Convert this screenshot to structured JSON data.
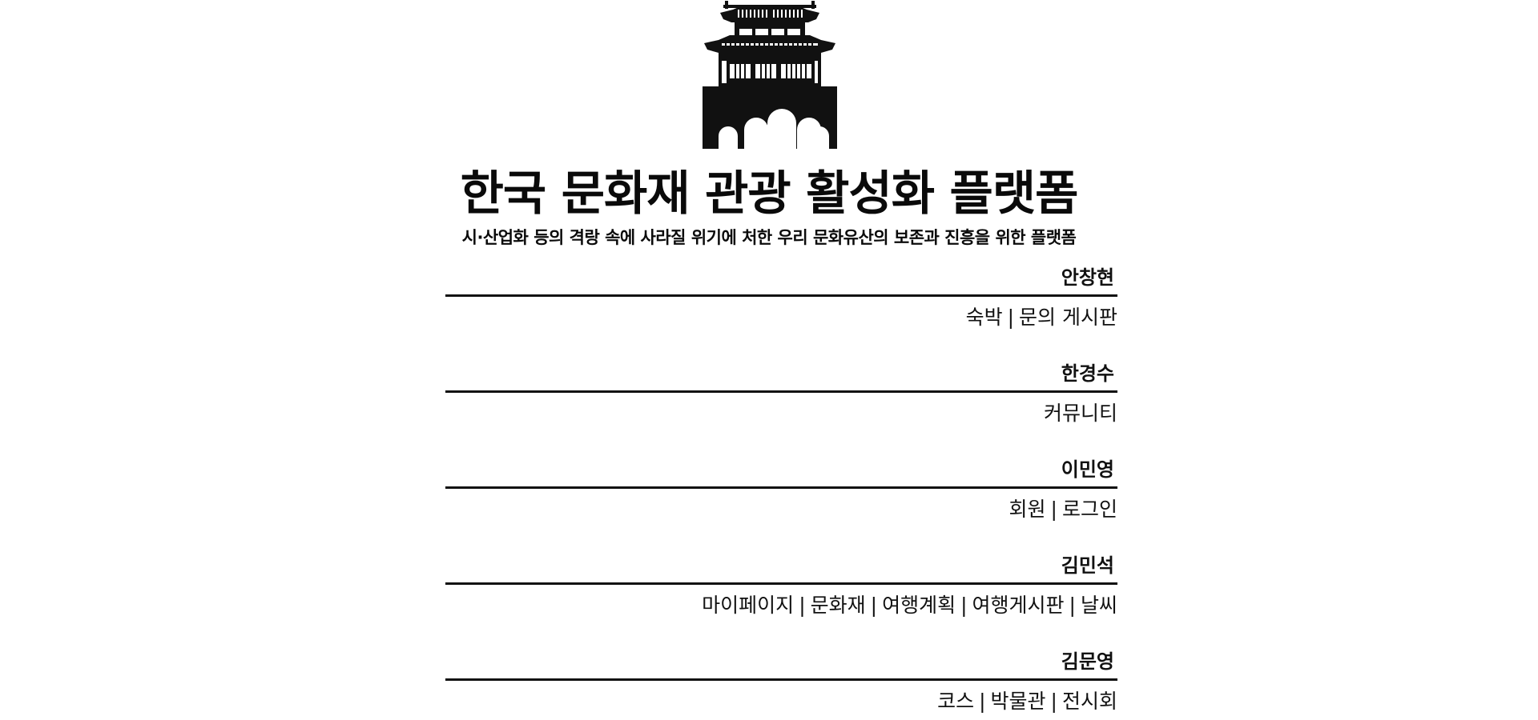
{
  "header": {
    "title": "한국 문화재 관광 활성화 플랫폼",
    "subtitle": "시·산업화 등의 격랑 속에 사라질 위기에 처한 우리 문화유산의 보존과 진흥을 위한 플랫폼",
    "logo_icon": "palace-gate-icon"
  },
  "separator": "|",
  "sections": [
    {
      "member": "안창현",
      "links": [
        "숙박",
        "문의 게시판"
      ]
    },
    {
      "member": "한경수",
      "links": [
        "커뮤니티"
      ]
    },
    {
      "member": "이민영",
      "links": [
        "회원",
        "로그인"
      ]
    },
    {
      "member": "김민석",
      "links": [
        "마이페이지",
        "문화재",
        "여행계획",
        "여행게시판",
        "날씨"
      ]
    },
    {
      "member": "김문영",
      "links": [
        "코스",
        "박물관",
        "전시회"
      ]
    }
  ]
}
